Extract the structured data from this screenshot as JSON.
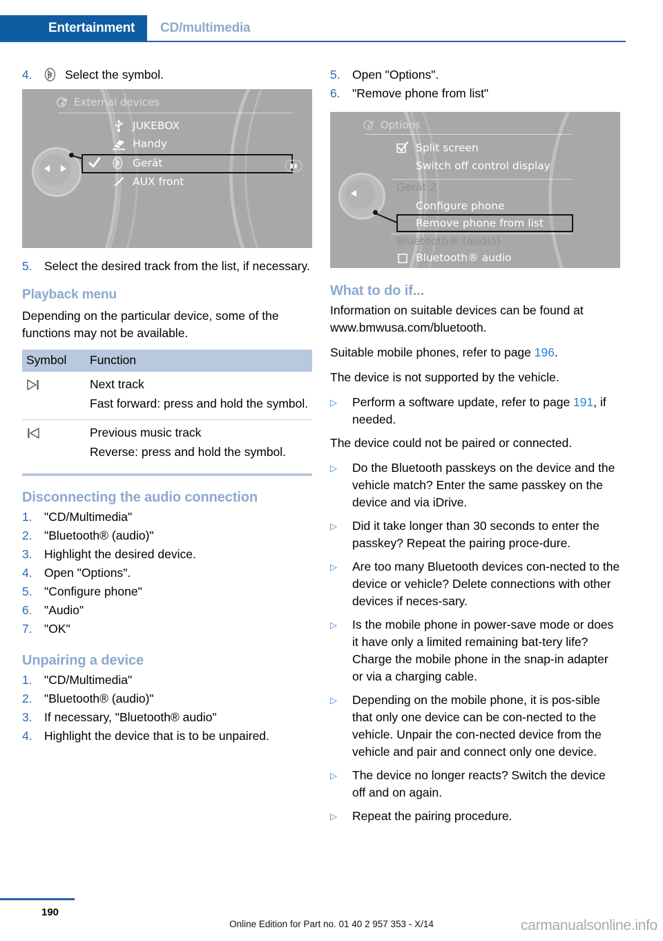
{
  "header": {
    "active_tab": "Entertainment",
    "inactive_tab": "CD/multimedia",
    "accent_color": "#0f5ca3",
    "inactive_color": "#8fa9ca"
  },
  "left_column": {
    "step4": {
      "num": "4.",
      "symbol": "bluetooth-circle-icon",
      "text": "Select the symbol."
    },
    "screenshot1": {
      "name": "external-devices-menu",
      "title": "External devices",
      "title_icon": "media-note-icon",
      "items": [
        {
          "icon": "usb-icon",
          "label": "JUKEBOX",
          "selected": false,
          "checked": false
        },
        {
          "icon": "snap-in-adapter-icon",
          "label": "Handy",
          "selected": false,
          "checked": false
        },
        {
          "icon": "bluetooth-icon",
          "label": "Gerät",
          "selected": true,
          "checked": true
        },
        {
          "icon": "aux-jack-icon",
          "label": "AUX front",
          "selected": false,
          "checked": false
        }
      ]
    },
    "step5": {
      "num": "5.",
      "text": "Select the desired track from the list, if necessary."
    },
    "playback": {
      "heading": "Playback menu",
      "intro": "Depending on the particular device, some of the functions may not be available.",
      "table": {
        "columns": [
          "Symbol",
          "Function"
        ],
        "rows": [
          {
            "symbol": "next-track-icon",
            "lines": [
              "Next track",
              "Fast forward: press and hold the symbol."
            ]
          },
          {
            "symbol": "previous-track-icon",
            "lines": [
              "Previous music track",
              "Reverse: press and hold the symbol."
            ]
          }
        ]
      }
    },
    "disconnect": {
      "heading": "Disconnecting the audio connection",
      "steps": [
        {
          "num": "1.",
          "text": "\"CD/Multimedia\""
        },
        {
          "num": "2.",
          "text": "\"Bluetooth® (audio)\""
        },
        {
          "num": "3.",
          "text": "Highlight the desired device."
        },
        {
          "num": "4.",
          "text": "Open \"Options\"."
        },
        {
          "num": "5.",
          "text": "\"Configure phone\""
        },
        {
          "num": "6.",
          "text": "\"Audio\""
        },
        {
          "num": "7.",
          "text": "\"OK\""
        }
      ]
    },
    "unpairing": {
      "heading": "Unpairing a device",
      "steps": [
        {
          "num": "1.",
          "text": "\"CD/Multimedia\""
        },
        {
          "num": "2.",
          "text": "\"Bluetooth® (audio)\""
        },
        {
          "num": "3.",
          "text": "If necessary, \"Bluetooth® audio\""
        },
        {
          "num": "4.",
          "text": "Highlight the device that is to be unpaired."
        }
      ]
    }
  },
  "right_column": {
    "steps": [
      {
        "num": "5.",
        "text": "Open \"Options\"."
      },
      {
        "num": "6.",
        "text": "\"Remove phone from list\""
      }
    ],
    "screenshot2": {
      "name": "options-menu",
      "title": "Options",
      "title_icon": "media-note-icon",
      "items": [
        {
          "label": "Split screen",
          "icon": "checkbox-checked-icon",
          "dim": false,
          "selected": false
        },
        {
          "label": "Switch off control display",
          "icon": "",
          "dim": false,
          "selected": false
        },
        {
          "label": "Gerät 2",
          "icon": "",
          "dim": true,
          "selected": false
        },
        {
          "label": "Configure phone",
          "icon": "",
          "dim": false,
          "selected": false
        },
        {
          "label": "Remove phone from list",
          "icon": "",
          "dim": false,
          "selected": true
        },
        {
          "label": "Bluetooth® (audio)",
          "icon": "",
          "dim": true,
          "selected": false
        },
        {
          "label": "Bluetooth® audio",
          "icon": "checkbox-empty-icon",
          "dim": false,
          "selected": false
        }
      ]
    },
    "what_to_do": {
      "heading": "What to do if...",
      "paragraphs": [
        "Information on suitable devices can be found at www.bmwusa.com/bluetooth."
      ],
      "ref_line_prefix": "Suitable mobile phones, refer to page ",
      "ref_page": "196",
      "ref_line_suffix": ".",
      "issue1": "The device is not supported by the vehicle.",
      "bullet1_prefix": "Perform a software update, refer to page ",
      "bullet1_page": "191",
      "bullet1_suffix": ", if needed.",
      "issue2": "The device could not be paired or connected.",
      "bullets": [
        "Do the Bluetooth passkeys on the device and the vehicle match? Enter the same passkey on the device and via iDrive.",
        "Did it take longer than 30 seconds to enter the passkey? Repeat the pairing proce-dure.",
        "Are too many Bluetooth devices con-nected to the device or vehicle? Delete connections with other devices if neces-sary.",
        "Is the mobile phone in power-save mode or does it have only a limited remaining bat-tery life? Charge the mobile phone in the snap-in adapter or via a charging cable.",
        "Depending on the mobile phone, it is pos-sible that only one device can be con-nected to the vehicle. Unpair the con-nected device from the vehicle and pair and connect only one device.",
        "The device no longer reacts? Switch the device off and on again.",
        "Repeat the pairing procedure."
      ]
    }
  },
  "footer": {
    "page_number": "190",
    "note": "Online Edition for Part no. 01 40 2 957 353 - X/14",
    "watermark": "carmanualsonline.info"
  }
}
